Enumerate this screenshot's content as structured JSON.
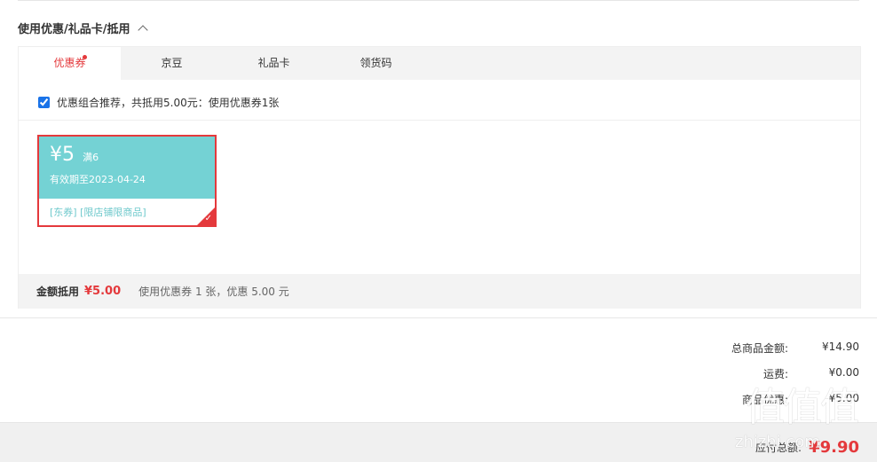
{
  "section": {
    "title": "使用优惠/礼品卡/抵用"
  },
  "tabs": [
    {
      "label": "优惠券"
    },
    {
      "label": "京豆"
    },
    {
      "label": "礼品卡"
    },
    {
      "label": "领货码"
    }
  ],
  "recommend": {
    "text": "优惠组合推荐，共抵用5.00元：使用优惠券1张",
    "checked": true
  },
  "coupon": {
    "amount": "¥5",
    "condition": "满6",
    "valid": "有效期至2023-04-24",
    "tags": "[东券] [限店铺限商品]"
  },
  "summary": {
    "label": "金额抵用",
    "value": "¥5.00",
    "detail": "使用优惠券 1 张，优惠 5.00 元"
  },
  "totals": {
    "goods_label": "总商品金额:",
    "goods_value": "¥14.90",
    "ship_label": "运费:",
    "ship_value": "¥0.00",
    "discount_label": "商品优惠:",
    "discount_value": "-¥5.00",
    "payable_label": "应付总额:",
    "payable_value": "¥9.90"
  },
  "watermark": {
    "glyphs": "值值值",
    "site": "zhizhi.com"
  },
  "colors": {
    "accent": "#e4393c",
    "coupon_bg": "#74d2d4"
  }
}
